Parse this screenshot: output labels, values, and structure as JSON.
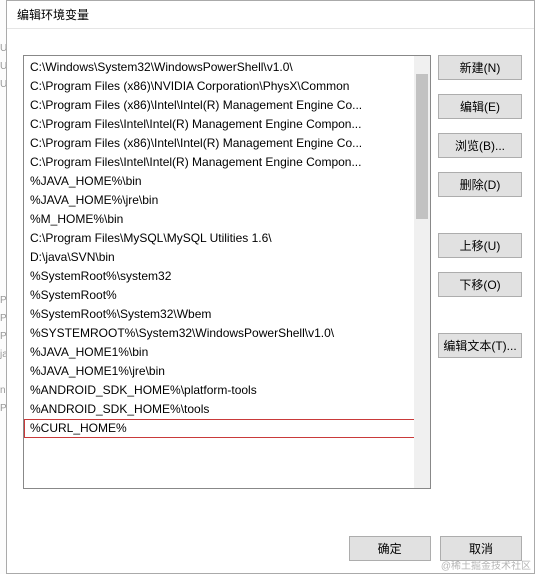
{
  "dialog": {
    "title": "编辑环境变量"
  },
  "list": {
    "items": [
      "C:\\Windows\\System32\\WindowsPowerShell\\v1.0\\",
      "C:\\Program Files (x86)\\NVIDIA Corporation\\PhysX\\Common",
      "C:\\Program Files (x86)\\Intel\\Intel(R) Management Engine Co...",
      "C:\\Program Files\\Intel\\Intel(R) Management Engine Compon...",
      "C:\\Program Files (x86)\\Intel\\Intel(R) Management Engine Co...",
      "C:\\Program Files\\Intel\\Intel(R) Management Engine Compon...",
      "%JAVA_HOME%\\bin",
      "%JAVA_HOME%\\jre\\bin",
      "%M_HOME%\\bin",
      "C:\\Program Files\\MySQL\\MySQL Utilities 1.6\\",
      "D:\\java\\SVN\\bin",
      "%SystemRoot%\\system32",
      "%SystemRoot%",
      "%SystemRoot%\\System32\\Wbem",
      "%SYSTEMROOT%\\System32\\WindowsPowerShell\\v1.0\\",
      "%JAVA_HOME1%\\bin",
      "%JAVA_HOME1%\\jre\\bin",
      "%ANDROID_SDK_HOME%\\platform-tools",
      "%ANDROID_SDK_HOME%\\tools",
      "%CURL_HOME%"
    ],
    "highlighted_index": 19
  },
  "buttons": {
    "new": "新建(N)",
    "edit": "编辑(E)",
    "browse": "浏览(B)...",
    "delete": "删除(D)",
    "move_up": "上移(U)",
    "move_down": "下移(O)",
    "edit_text": "编辑文本(T)...",
    "ok": "确定",
    "cancel": "取消"
  },
  "watermark": "@稀土掘金技术社区"
}
